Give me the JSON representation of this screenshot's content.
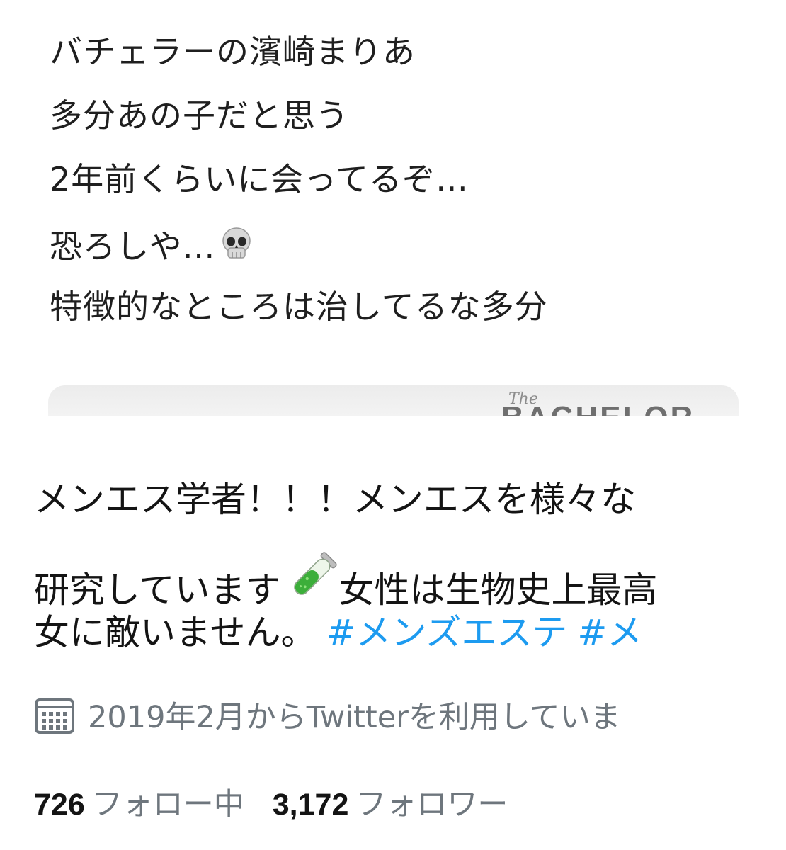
{
  "tweet": {
    "lines": [
      "バチェラーの濱崎まりあ",
      "多分あの子だと思う",
      "2年前くらいに会ってるぞ…",
      "恐ろしや…",
      "特徴的なところは治してるな多分"
    ],
    "emoji_icon": "skull-icon",
    "media_logo_text": "The BACHELOR"
  },
  "profile": {
    "bio": {
      "line1": "メンエス学者！！！メンエスを様々な",
      "line2a": "研究しています",
      "tube_icon": "test-tube-icon",
      "line2b": "女性は生物史上最高",
      "line3": "女に敵いません。",
      "hashtag1": "#メンズエステ",
      "hashtag2": "#メ"
    },
    "joined": {
      "icon": "calendar-icon",
      "text": "2019年2月からTwitterを利用していま"
    },
    "follow": {
      "following_count": "726",
      "following_label": "フォロー中",
      "followers_count": "3,172",
      "followers_label": "フォロワー"
    }
  },
  "colors": {
    "link": "#1d9bf0",
    "secondary_text": "#6e767d",
    "primary_text": "#141414"
  }
}
